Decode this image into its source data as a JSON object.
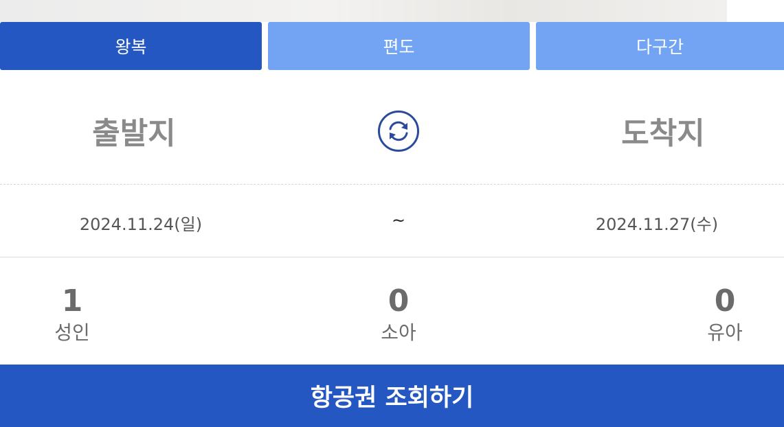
{
  "trip_tabs": [
    {
      "label": "왕복",
      "active": true
    },
    {
      "label": "편도",
      "active": false
    },
    {
      "label": "다구간",
      "active": false
    }
  ],
  "route": {
    "departure": "출발지",
    "arrival": "도착지",
    "swap_icon": "swap-arrows-icon"
  },
  "dates": {
    "depart": "2024.11.24(일)",
    "separator": "~",
    "return": "2024.11.27(수)"
  },
  "passengers": [
    {
      "count": "1",
      "label": "성인"
    },
    {
      "count": "0",
      "label": "소아"
    },
    {
      "count": "0",
      "label": "유아"
    }
  ],
  "search_button": "항공권 조회하기",
  "colors": {
    "primary": "#2457c2",
    "tab_inactive": "#72a4f3",
    "city_text": "#8a8a8a",
    "icon_stroke": "#2a4a9e"
  }
}
